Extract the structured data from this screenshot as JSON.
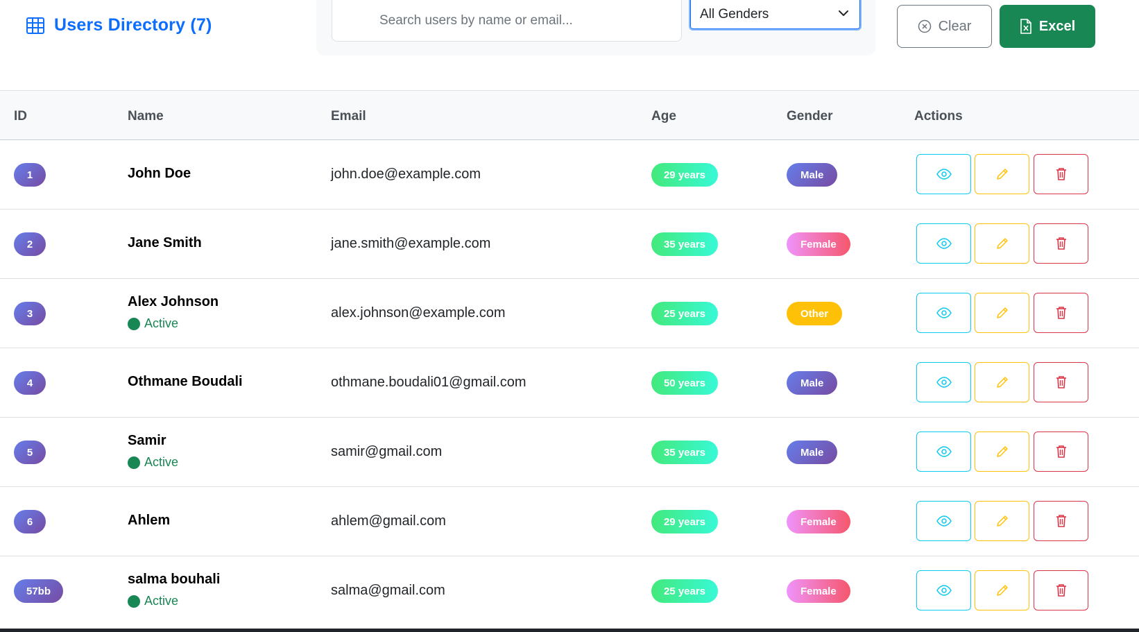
{
  "header": {
    "title": "Users Directory (7)",
    "title_icon": "table-icon"
  },
  "filters": {
    "search_placeholder": "Search users by name or email...",
    "gender_select": "All Genders",
    "clear_label": "Clear",
    "excel_label": "Excel"
  },
  "table": {
    "columns": [
      "ID",
      "Name",
      "Email",
      "Age",
      "Gender",
      "Actions"
    ],
    "rows": [
      {
        "id": "1",
        "name": "John Doe",
        "status": "",
        "email": "john.doe@example.com",
        "age": "29 years",
        "gender": "Male"
      },
      {
        "id": "2",
        "name": "Jane Smith",
        "status": "",
        "email": "jane.smith@example.com",
        "age": "35 years",
        "gender": "Female"
      },
      {
        "id": "3",
        "name": "Alex Johnson",
        "status": "Active",
        "email": "alex.johnson@example.com",
        "age": "25 years",
        "gender": "Other"
      },
      {
        "id": "4",
        "name": "Othmane Boudali",
        "status": "",
        "email": "othmane.boudali01@gmail.com",
        "age": "50 years",
        "gender": "Male"
      },
      {
        "id": "5",
        "name": "Samir",
        "status": "Active",
        "email": "samir@gmail.com",
        "age": "35 years",
        "gender": "Male"
      },
      {
        "id": "6",
        "name": "Ahlem",
        "status": "",
        "email": "ahlem@gmail.com",
        "age": "29 years",
        "gender": "Female"
      },
      {
        "id": "57bb",
        "name": "salma bouhali",
        "status": "Active",
        "email": "salma@gmail.com",
        "age": "25 years",
        "gender": "Female"
      }
    ]
  },
  "colors": {
    "primary": "#0d6efd",
    "success": "#198754",
    "info": "#0dcaf0",
    "warning": "#ffc107",
    "danger": "#dc3545"
  },
  "icons": {
    "view": "eye-icon",
    "edit": "pencil-icon",
    "delete": "trash-icon",
    "clear": "x-circle-icon",
    "excel": "excel-file-icon",
    "select": "chevron-down-icon"
  }
}
